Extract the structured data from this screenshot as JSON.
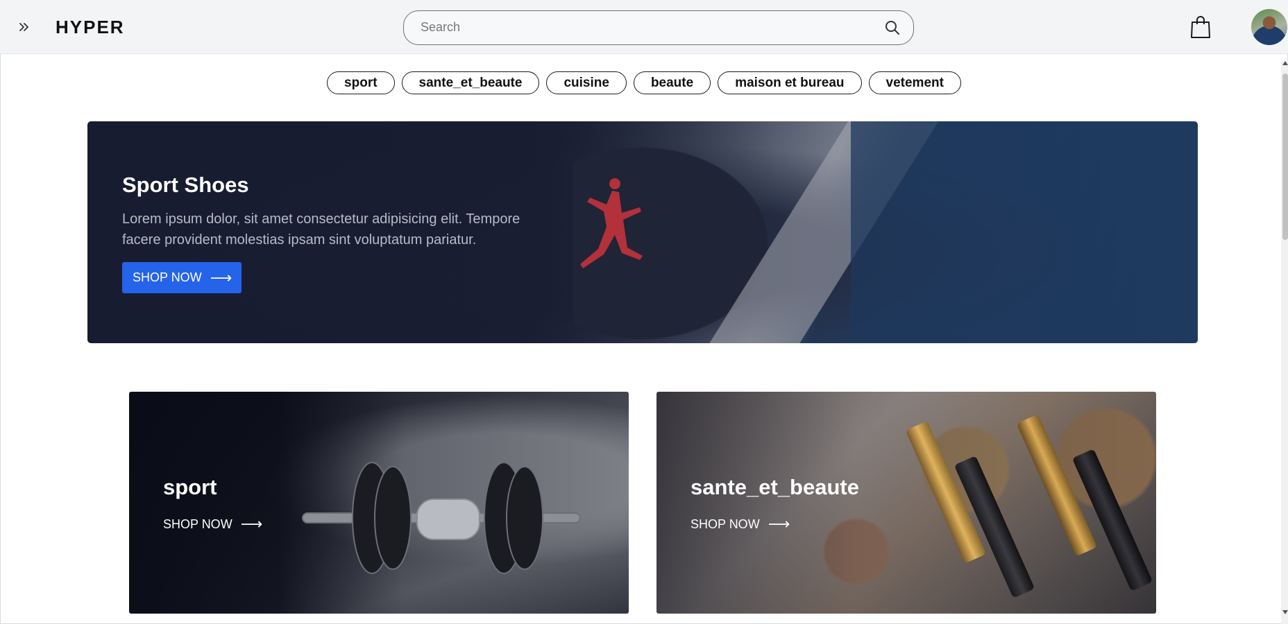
{
  "header": {
    "brand": "HYPER",
    "search_placeholder": "Search",
    "search_value": "",
    "icons": {
      "toggle": "double-chevron-right-icon",
      "search": "search-icon",
      "cart": "shopping-bag-icon",
      "avatar": "user-avatar"
    }
  },
  "categories": [
    "sport",
    "sante_et_beaute",
    "cuisine",
    "beaute",
    "maison et bureau",
    "vetement"
  ],
  "hero": {
    "title": "Sport Shoes",
    "description": "Lorem ipsum dolor, sit amet consectetur adipisicing elit. Tempore facere provident molestias ipsam sint voluptatum pariatur.",
    "button_label": "SHOP NOW",
    "button_icon": "arrow-right-icon"
  },
  "cards": [
    {
      "title": "sport",
      "link_label": "SHOP NOW",
      "link_icon": "arrow-right-icon"
    },
    {
      "title": "sante_et_beaute",
      "link_label": "SHOP NOW",
      "link_icon": "arrow-right-icon"
    }
  ],
  "colors": {
    "primary_button": "#2563eb",
    "header_bg": "#f3f4f6",
    "hero_bg": "#1c2033"
  }
}
